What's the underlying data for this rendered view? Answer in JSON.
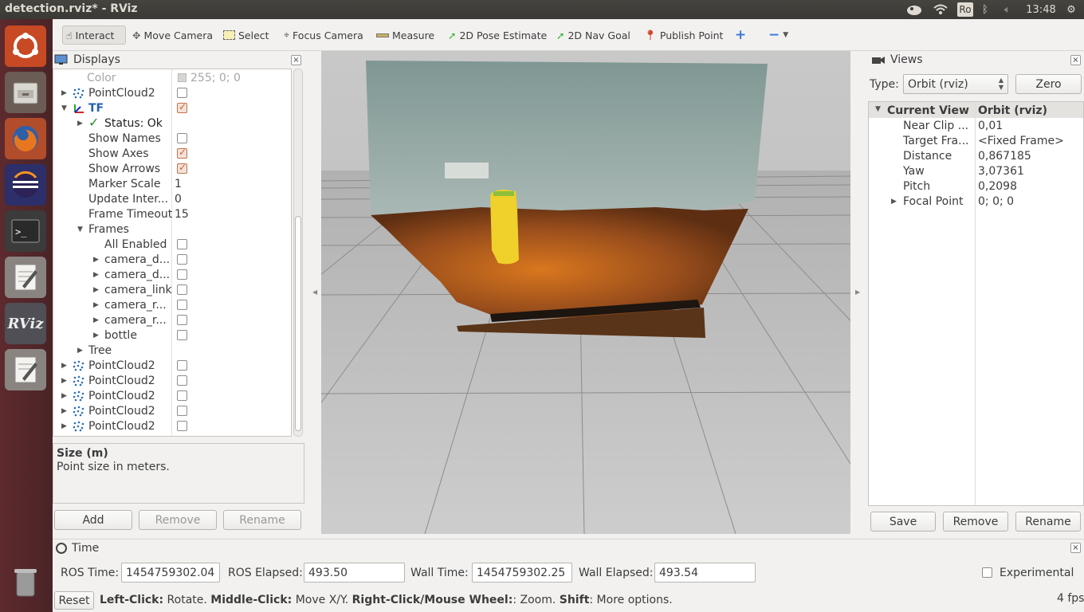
{
  "window": {
    "title": "detection.rviz* - RViz"
  },
  "tray": {
    "keyboard": "Ro",
    "time": "13:48"
  },
  "toolbar": {
    "tools": [
      {
        "label": "Interact"
      },
      {
        "label": "Move Camera"
      },
      {
        "label": "Select"
      },
      {
        "label": "Focus Camera"
      },
      {
        "label": "Measure"
      },
      {
        "label": "2D Pose Estimate"
      },
      {
        "label": "2D Nav Goal"
      },
      {
        "label": "Publish Point"
      }
    ]
  },
  "displays": {
    "title": "Displays",
    "color_row": {
      "label": "Color",
      "value": "255; 0; 0"
    },
    "rows": [
      {
        "label": "PointCloud2"
      },
      {
        "label": "TF"
      },
      {
        "label": "Status: Ok"
      },
      {
        "label": "Show Names"
      },
      {
        "label": "Show Axes"
      },
      {
        "label": "Show Arrows"
      },
      {
        "label": "Marker Scale",
        "value": "1"
      },
      {
        "label": "Update Inter...",
        "value": "0"
      },
      {
        "label": "Frame Timeout",
        "value": "15"
      },
      {
        "label": "Frames"
      },
      {
        "label": "All Enabled"
      },
      {
        "label": "camera_d..."
      },
      {
        "label": "camera_d..."
      },
      {
        "label": "camera_link"
      },
      {
        "label": "camera_r..."
      },
      {
        "label": "camera_r..."
      },
      {
        "label": "bottle"
      },
      {
        "label": "Tree"
      },
      {
        "label": "PointCloud2"
      },
      {
        "label": "PointCloud2"
      },
      {
        "label": "PointCloud2"
      },
      {
        "label": "PointCloud2"
      },
      {
        "label": "PointCloud2"
      }
    ],
    "help_title": "Size (m)",
    "help_text": "Point size in meters.",
    "buttons": {
      "add": "Add",
      "remove": "Remove",
      "rename": "Rename"
    }
  },
  "views": {
    "title": "Views",
    "type_label": "Type:",
    "type_value": "Orbit (rviz)",
    "zero": "Zero",
    "header": {
      "name": "Current View",
      "value": "Orbit (rviz)"
    },
    "props": [
      {
        "name": "Near Clip ...",
        "value": "0,01"
      },
      {
        "name": "Target Fra...",
        "value": "<Fixed Frame>"
      },
      {
        "name": "Distance",
        "value": "0,867185"
      },
      {
        "name": "Yaw",
        "value": "3,07361"
      },
      {
        "name": "Pitch",
        "value": "0,2098"
      },
      {
        "name": "Focal Point",
        "value": "0; 0; 0"
      }
    ],
    "buttons": {
      "save": "Save",
      "remove": "Remove",
      "rename": "Rename"
    }
  },
  "time": {
    "title": "Time",
    "ros_time_label": "ROS Time:",
    "ros_time": "1454759302.04",
    "ros_elapsed_label": "ROS Elapsed:",
    "ros_elapsed": "493.50",
    "wall_time_label": "Wall Time:",
    "wall_time": "1454759302.25",
    "wall_elapsed_label": "Wall Elapsed:",
    "wall_elapsed": "493.54",
    "experimental": "Experimental"
  },
  "status": {
    "reset": "Reset",
    "h1": "Left-Click:",
    "t1": " Rotate. ",
    "h2": "Middle-Click:",
    "t2": " Move X/Y. ",
    "h3": "Right-Click/Mouse Wheel:",
    "t3": ": Zoom. ",
    "h4": "Shift",
    "t4": ": More options.",
    "fps": "4 fps"
  },
  "colors": {
    "accent_tf": "#1f5fb3",
    "launcher": "#5d2a2e",
    "check": "#e05a28"
  }
}
